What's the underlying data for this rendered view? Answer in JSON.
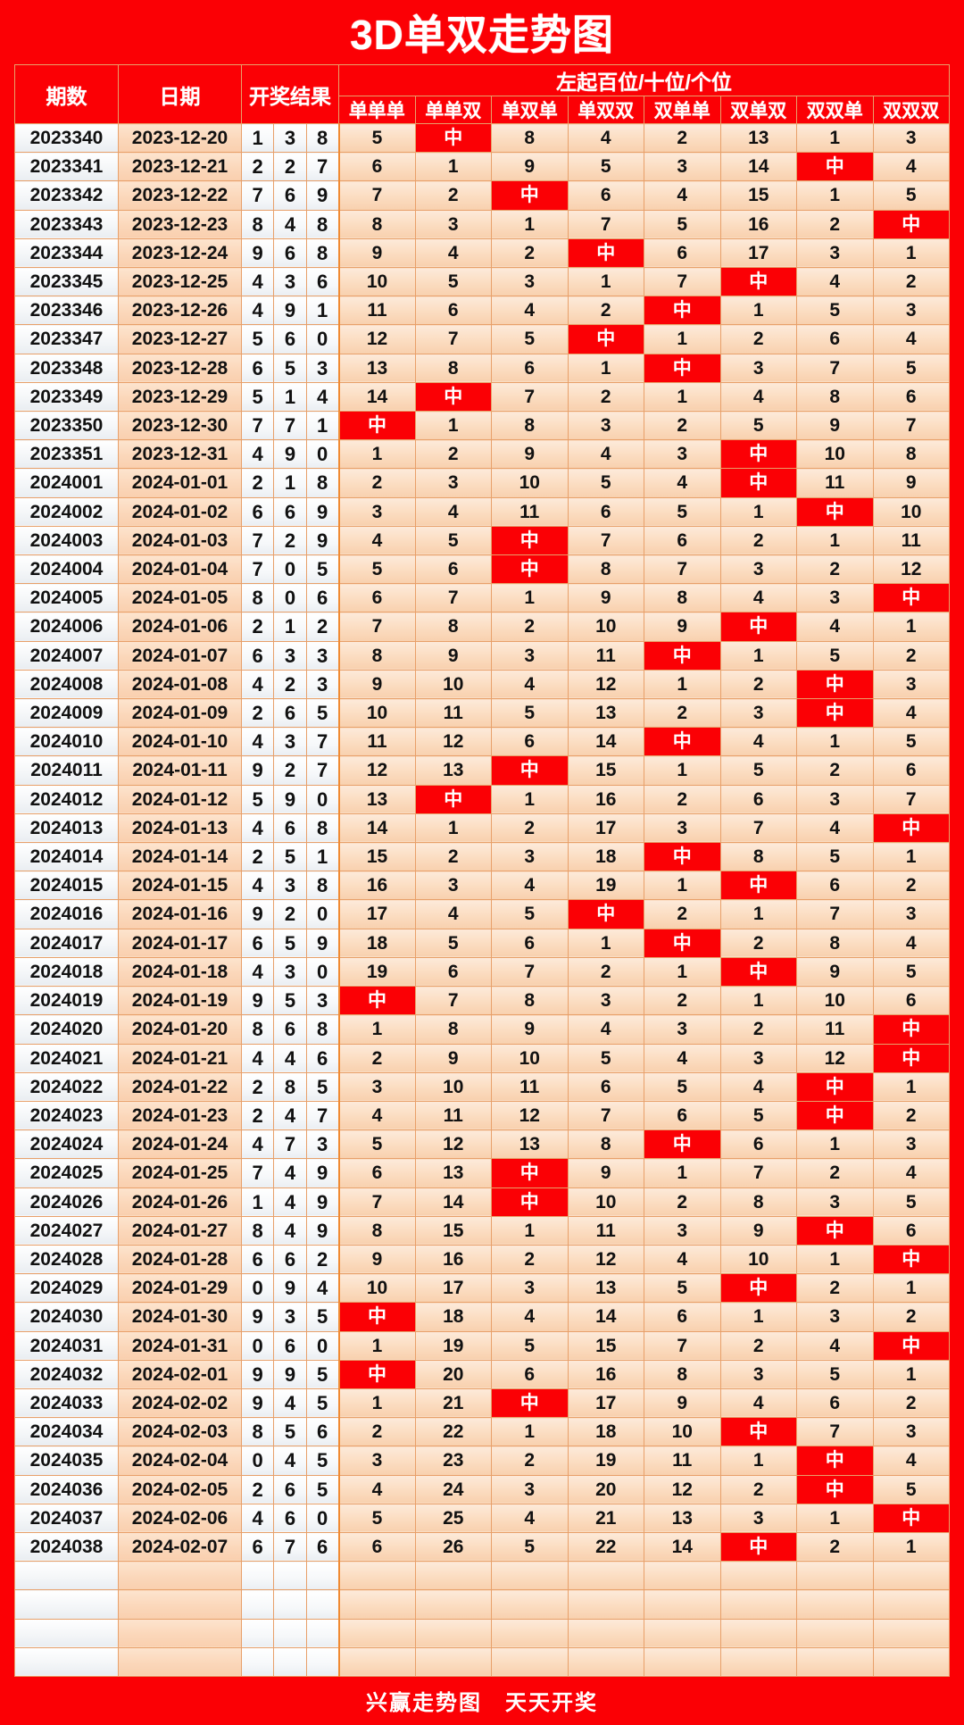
{
  "title": "3D单双走势图",
  "footer": "兴赢走势图　天天开奖",
  "colors": {
    "brand_red": "#fb0005",
    "header_text": "#ffffff",
    "cell_orange": "#fbd7ba",
    "divider_orange": "#f08a32"
  },
  "header": {
    "qi": "期数",
    "date": "日期",
    "result": "开奖结果",
    "group": "左起百位/十位/个位",
    "subs": [
      "单单单",
      "单单双",
      "单双单",
      "单双双",
      "双单单",
      "双单双",
      "双双单",
      "双双双"
    ]
  },
  "hit_label": "中",
  "blank_rows": 4,
  "chart_data": {
    "type": "table",
    "title": "3D单双走势图",
    "columns": [
      "期数",
      "日期",
      "开奖结果",
      "单单单",
      "单单双",
      "单双单",
      "单双双",
      "双单单",
      "双单双",
      "双双单",
      "双双双"
    ],
    "rows": [
      {
        "qi": "2023340",
        "date": "2023-12-20",
        "balls": [
          1,
          3,
          8
        ],
        "stats": [
          "5",
          "中",
          "8",
          "4",
          "2",
          "13",
          "1",
          "3"
        ]
      },
      {
        "qi": "2023341",
        "date": "2023-12-21",
        "balls": [
          2,
          2,
          7
        ],
        "stats": [
          "6",
          "1",
          "9",
          "5",
          "3",
          "14",
          "中",
          "4"
        ]
      },
      {
        "qi": "2023342",
        "date": "2023-12-22",
        "balls": [
          7,
          6,
          9
        ],
        "stats": [
          "7",
          "2",
          "中",
          "6",
          "4",
          "15",
          "1",
          "5"
        ]
      },
      {
        "qi": "2023343",
        "date": "2023-12-23",
        "balls": [
          8,
          4,
          8
        ],
        "stats": [
          "8",
          "3",
          "1",
          "7",
          "5",
          "16",
          "2",
          "中"
        ]
      },
      {
        "qi": "2023344",
        "date": "2023-12-24",
        "balls": [
          9,
          6,
          8
        ],
        "stats": [
          "9",
          "4",
          "2",
          "中",
          "6",
          "17",
          "3",
          "1"
        ]
      },
      {
        "qi": "2023345",
        "date": "2023-12-25",
        "balls": [
          4,
          3,
          6
        ],
        "stats": [
          "10",
          "5",
          "3",
          "1",
          "7",
          "中",
          "4",
          "2"
        ]
      },
      {
        "qi": "2023346",
        "date": "2023-12-26",
        "balls": [
          4,
          9,
          1
        ],
        "stats": [
          "11",
          "6",
          "4",
          "2",
          "中",
          "1",
          "5",
          "3"
        ]
      },
      {
        "qi": "2023347",
        "date": "2023-12-27",
        "balls": [
          5,
          6,
          0
        ],
        "stats": [
          "12",
          "7",
          "5",
          "中",
          "1",
          "2",
          "6",
          "4"
        ]
      },
      {
        "qi": "2023348",
        "date": "2023-12-28",
        "balls": [
          6,
          5,
          3
        ],
        "stats": [
          "13",
          "8",
          "6",
          "1",
          "中",
          "3",
          "7",
          "5"
        ]
      },
      {
        "qi": "2023349",
        "date": "2023-12-29",
        "balls": [
          5,
          1,
          4
        ],
        "stats": [
          "14",
          "中",
          "7",
          "2",
          "1",
          "4",
          "8",
          "6"
        ]
      },
      {
        "qi": "2023350",
        "date": "2023-12-30",
        "balls": [
          7,
          7,
          1
        ],
        "stats": [
          "中",
          "1",
          "8",
          "3",
          "2",
          "5",
          "9",
          "7"
        ]
      },
      {
        "qi": "2023351",
        "date": "2023-12-31",
        "balls": [
          4,
          9,
          0
        ],
        "stats": [
          "1",
          "2",
          "9",
          "4",
          "3",
          "中",
          "10",
          "8"
        ]
      },
      {
        "qi": "2024001",
        "date": "2024-01-01",
        "balls": [
          2,
          1,
          8
        ],
        "stats": [
          "2",
          "3",
          "10",
          "5",
          "4",
          "中",
          "11",
          "9"
        ]
      },
      {
        "qi": "2024002",
        "date": "2024-01-02",
        "balls": [
          6,
          6,
          9
        ],
        "stats": [
          "3",
          "4",
          "11",
          "6",
          "5",
          "1",
          "中",
          "10"
        ]
      },
      {
        "qi": "2024003",
        "date": "2024-01-03",
        "balls": [
          7,
          2,
          9
        ],
        "stats": [
          "4",
          "5",
          "中",
          "7",
          "6",
          "2",
          "1",
          "11"
        ]
      },
      {
        "qi": "2024004",
        "date": "2024-01-04",
        "balls": [
          7,
          0,
          5
        ],
        "stats": [
          "5",
          "6",
          "中",
          "8",
          "7",
          "3",
          "2",
          "12"
        ]
      },
      {
        "qi": "2024005",
        "date": "2024-01-05",
        "balls": [
          8,
          0,
          6
        ],
        "stats": [
          "6",
          "7",
          "1",
          "9",
          "8",
          "4",
          "3",
          "中"
        ]
      },
      {
        "qi": "2024006",
        "date": "2024-01-06",
        "balls": [
          2,
          1,
          2
        ],
        "stats": [
          "7",
          "8",
          "2",
          "10",
          "9",
          "中",
          "4",
          "1"
        ]
      },
      {
        "qi": "2024007",
        "date": "2024-01-07",
        "balls": [
          6,
          3,
          3
        ],
        "stats": [
          "8",
          "9",
          "3",
          "11",
          "中",
          "1",
          "5",
          "2"
        ]
      },
      {
        "qi": "2024008",
        "date": "2024-01-08",
        "balls": [
          4,
          2,
          3
        ],
        "stats": [
          "9",
          "10",
          "4",
          "12",
          "1",
          "2",
          "中",
          "3"
        ]
      },
      {
        "qi": "2024009",
        "date": "2024-01-09",
        "balls": [
          2,
          6,
          5
        ],
        "stats": [
          "10",
          "11",
          "5",
          "13",
          "2",
          "3",
          "中",
          "4"
        ]
      },
      {
        "qi": "2024010",
        "date": "2024-01-10",
        "balls": [
          4,
          3,
          7
        ],
        "stats": [
          "11",
          "12",
          "6",
          "14",
          "中",
          "4",
          "1",
          "5"
        ]
      },
      {
        "qi": "2024011",
        "date": "2024-01-11",
        "balls": [
          9,
          2,
          7
        ],
        "stats": [
          "12",
          "13",
          "中",
          "15",
          "1",
          "5",
          "2",
          "6"
        ]
      },
      {
        "qi": "2024012",
        "date": "2024-01-12",
        "balls": [
          5,
          9,
          0
        ],
        "stats": [
          "13",
          "中",
          "1",
          "16",
          "2",
          "6",
          "3",
          "7"
        ]
      },
      {
        "qi": "2024013",
        "date": "2024-01-13",
        "balls": [
          4,
          6,
          8
        ],
        "stats": [
          "14",
          "1",
          "2",
          "17",
          "3",
          "7",
          "4",
          "中"
        ]
      },
      {
        "qi": "2024014",
        "date": "2024-01-14",
        "balls": [
          2,
          5,
          1
        ],
        "stats": [
          "15",
          "2",
          "3",
          "18",
          "中",
          "8",
          "5",
          "1"
        ]
      },
      {
        "qi": "2024015",
        "date": "2024-01-15",
        "balls": [
          4,
          3,
          8
        ],
        "stats": [
          "16",
          "3",
          "4",
          "19",
          "1",
          "中",
          "6",
          "2"
        ]
      },
      {
        "qi": "2024016",
        "date": "2024-01-16",
        "balls": [
          9,
          2,
          0
        ],
        "stats": [
          "17",
          "4",
          "5",
          "中",
          "2",
          "1",
          "7",
          "3"
        ]
      },
      {
        "qi": "2024017",
        "date": "2024-01-17",
        "balls": [
          6,
          5,
          9
        ],
        "stats": [
          "18",
          "5",
          "6",
          "1",
          "中",
          "2",
          "8",
          "4"
        ]
      },
      {
        "qi": "2024018",
        "date": "2024-01-18",
        "balls": [
          4,
          3,
          0
        ],
        "stats": [
          "19",
          "6",
          "7",
          "2",
          "1",
          "中",
          "9",
          "5"
        ]
      },
      {
        "qi": "2024019",
        "date": "2024-01-19",
        "balls": [
          9,
          5,
          3
        ],
        "stats": [
          "中",
          "7",
          "8",
          "3",
          "2",
          "1",
          "10",
          "6"
        ]
      },
      {
        "qi": "2024020",
        "date": "2024-01-20",
        "balls": [
          8,
          6,
          8
        ],
        "stats": [
          "1",
          "8",
          "9",
          "4",
          "3",
          "2",
          "11",
          "中"
        ]
      },
      {
        "qi": "2024021",
        "date": "2024-01-21",
        "balls": [
          4,
          4,
          6
        ],
        "stats": [
          "2",
          "9",
          "10",
          "5",
          "4",
          "3",
          "12",
          "中"
        ]
      },
      {
        "qi": "2024022",
        "date": "2024-01-22",
        "balls": [
          2,
          8,
          5
        ],
        "stats": [
          "3",
          "10",
          "11",
          "6",
          "5",
          "4",
          "中",
          "1"
        ]
      },
      {
        "qi": "2024023",
        "date": "2024-01-23",
        "balls": [
          2,
          4,
          7
        ],
        "stats": [
          "4",
          "11",
          "12",
          "7",
          "6",
          "5",
          "中",
          "2"
        ]
      },
      {
        "qi": "2024024",
        "date": "2024-01-24",
        "balls": [
          4,
          7,
          3
        ],
        "stats": [
          "5",
          "12",
          "13",
          "8",
          "中",
          "6",
          "1",
          "3"
        ]
      },
      {
        "qi": "2024025",
        "date": "2024-01-25",
        "balls": [
          7,
          4,
          9
        ],
        "stats": [
          "6",
          "13",
          "中",
          "9",
          "1",
          "7",
          "2",
          "4"
        ]
      },
      {
        "qi": "2024026",
        "date": "2024-01-26",
        "balls": [
          1,
          4,
          9
        ],
        "stats": [
          "7",
          "14",
          "中",
          "10",
          "2",
          "8",
          "3",
          "5"
        ]
      },
      {
        "qi": "2024027",
        "date": "2024-01-27",
        "balls": [
          8,
          4,
          9
        ],
        "stats": [
          "8",
          "15",
          "1",
          "11",
          "3",
          "9",
          "中",
          "6"
        ]
      },
      {
        "qi": "2024028",
        "date": "2024-01-28",
        "balls": [
          6,
          6,
          2
        ],
        "stats": [
          "9",
          "16",
          "2",
          "12",
          "4",
          "10",
          "1",
          "中"
        ]
      },
      {
        "qi": "2024029",
        "date": "2024-01-29",
        "balls": [
          0,
          9,
          4
        ],
        "stats": [
          "10",
          "17",
          "3",
          "13",
          "5",
          "中",
          "2",
          "1"
        ]
      },
      {
        "qi": "2024030",
        "date": "2024-01-30",
        "balls": [
          9,
          3,
          5
        ],
        "stats": [
          "中",
          "18",
          "4",
          "14",
          "6",
          "1",
          "3",
          "2"
        ]
      },
      {
        "qi": "2024031",
        "date": "2024-01-31",
        "balls": [
          0,
          6,
          0
        ],
        "stats": [
          "1",
          "19",
          "5",
          "15",
          "7",
          "2",
          "4",
          "中"
        ]
      },
      {
        "qi": "2024032",
        "date": "2024-02-01",
        "balls": [
          9,
          9,
          5
        ],
        "stats": [
          "中",
          "20",
          "6",
          "16",
          "8",
          "3",
          "5",
          "1"
        ]
      },
      {
        "qi": "2024033",
        "date": "2024-02-02",
        "balls": [
          9,
          4,
          5
        ],
        "stats": [
          "1",
          "21",
          "中",
          "17",
          "9",
          "4",
          "6",
          "2"
        ]
      },
      {
        "qi": "2024034",
        "date": "2024-02-03",
        "balls": [
          8,
          5,
          6
        ],
        "stats": [
          "2",
          "22",
          "1",
          "18",
          "10",
          "中",
          "7",
          "3"
        ]
      },
      {
        "qi": "2024035",
        "date": "2024-02-04",
        "balls": [
          0,
          4,
          5
        ],
        "stats": [
          "3",
          "23",
          "2",
          "19",
          "11",
          "1",
          "中",
          "4"
        ]
      },
      {
        "qi": "2024036",
        "date": "2024-02-05",
        "balls": [
          2,
          6,
          5
        ],
        "stats": [
          "4",
          "24",
          "3",
          "20",
          "12",
          "2",
          "中",
          "5"
        ]
      },
      {
        "qi": "2024037",
        "date": "2024-02-06",
        "balls": [
          4,
          6,
          0
        ],
        "stats": [
          "5",
          "25",
          "4",
          "21",
          "13",
          "3",
          "1",
          "中"
        ]
      },
      {
        "qi": "2024038",
        "date": "2024-02-07",
        "balls": [
          6,
          7,
          6
        ],
        "stats": [
          "6",
          "26",
          "5",
          "22",
          "14",
          "中",
          "2",
          "1"
        ]
      }
    ]
  }
}
